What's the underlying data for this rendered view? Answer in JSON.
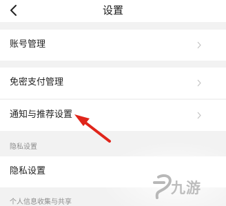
{
  "header": {
    "title": "设置",
    "back_icon": "chevron-left-icon"
  },
  "rows": [
    {
      "label": "账号管理",
      "icon": "chevron-right-icon"
    },
    {
      "label": "免密支付管理",
      "icon": "chevron-right-icon"
    },
    {
      "label": "通知与推荐设置",
      "icon": "chevron-right-icon"
    }
  ],
  "privacy_section": {
    "title": "隐私设置",
    "row_label": "隐私设置"
  },
  "personal_info_section": {
    "title": "个人信息收集与共享"
  },
  "annotation": {
    "arrow_color": "#e0251b"
  },
  "watermark": {
    "text": "九游"
  },
  "colors": {
    "background": "#f2f2f2",
    "surface": "#ffffff",
    "text": "#222222",
    "secondary_text": "#8e8e8e",
    "chevron": "#bdbdbd"
  }
}
